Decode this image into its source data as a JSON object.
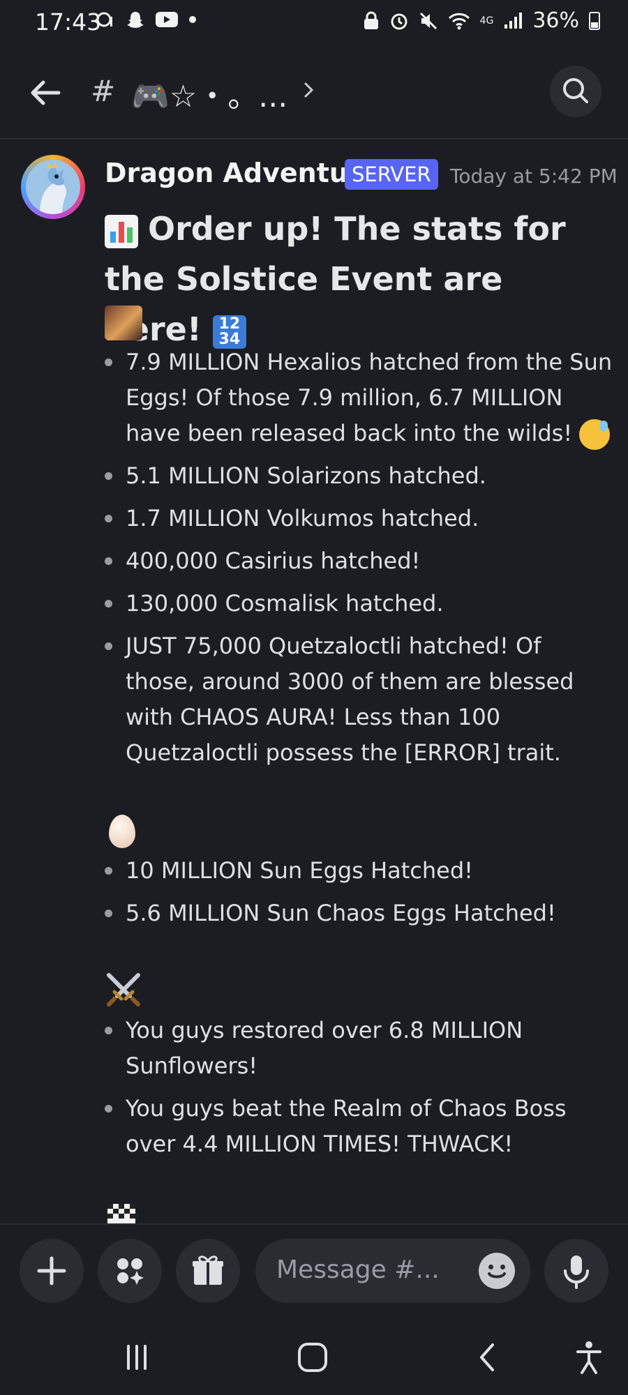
{
  "status_bar": {
    "time": "17:43",
    "network": "4G",
    "battery": "36%"
  },
  "header": {
    "hash": "#",
    "channel_name": "🎮☆・。..."
  },
  "message": {
    "author": "Dragon Adventur...",
    "tag": "SERVER",
    "timestamp": "Today at 5:42 PM",
    "headline": "Order up! The stats for the Solstice Event are here!",
    "number_emoji_top": "12",
    "number_emoji_bottom": "34",
    "section1": [
      "7.9 MILLION Hexalios hatched from the Sun Eggs! Of those 7.9 million, 6.7 MILLION have been released back into the wilds!",
      "5.1 MILLION Solarizons hatched.",
      "1.7 MILLION Volkumos hatched.",
      "400,000 Casirius hatched!",
      "130,000 Cosmalisk hatched.",
      "JUST 75,000 Quetzaloctli hatched! Of those, around 3000 of them are blessed with CHAOS AURA! Less than 100 Quetzaloctli possess the [ERROR] trait."
    ],
    "section2": [
      "10 MILLION Sun Eggs Hatched!",
      "5.6 MILLION Sun Chaos Eggs Hatched!"
    ],
    "section3": [
      "You guys restored over 6.8 MILLION Sunflowers!",
      "You guys beat the Realm of Chaos Boss over 4.4 MILLION TIMES! THWACK!"
    ]
  },
  "composer": {
    "placeholder": "Message #..."
  },
  "icons": {
    "back": "arrow-left-icon",
    "search": "search-icon",
    "add": "plus-icon",
    "apps": "apps-icon",
    "gift": "gift-icon",
    "emoji": "smile-icon",
    "mic": "microphone-icon"
  }
}
